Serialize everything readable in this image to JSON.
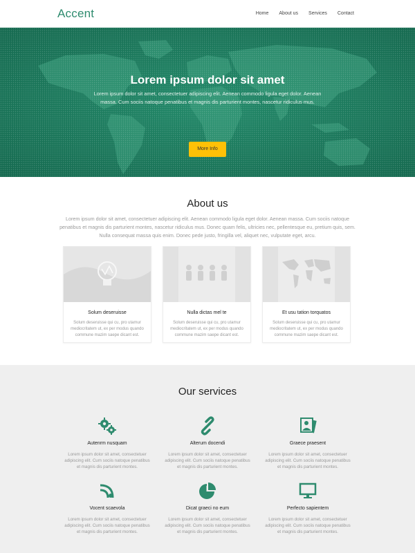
{
  "header": {
    "logo": "Accent",
    "nav": [
      "Home",
      "About us",
      "Services",
      "Contact"
    ]
  },
  "hero": {
    "title": "Lorem ipsum dolor sit amet",
    "text": "Lorem ipsum dolor sit amet, consectetuer adipiscing elit. Aenean commodo ligula eget dolor. Aenean massa. Cum sociis natoque penatibus et magnis dis parturient montes, nascetur ridiculus mus.",
    "button": "More Info"
  },
  "about": {
    "title": "About us",
    "text": "Lorem ipsum dolor sit amet, consectetuer adipiscing elit. Aenean commodo ligula eget dolor. Aenean massa. Cum sociis natoque penatibus et magnis dis parturient montes, nascetur ridiculus mus. Donec quam felis, ultricies nec, pellentesque eu, pretium quis, sem. Nulla consequat massa quis enim. Donec pede justo, fringilla vel, aliquet nec, vulputate eget, arcu.",
    "cards": [
      {
        "title": "Solum deseruisse",
        "text": "Solum deseruisse qui cu, pro utamur mediocritatem ut, ex per modus quando commune mazim saepe dicant est."
      },
      {
        "title": "Nulla dictas mel te",
        "text": "Solum deseruisse qui cu, pro utamur mediocritatem ut, ex per modus quando commune mazim saepe dicant est."
      },
      {
        "title": "Et usu tation torquatos",
        "text": "Solum deseruisse qui cu, pro utamur mediocritatem ut, ex per modus quando commune mazim saepe dicant est."
      }
    ]
  },
  "services": {
    "title": "Our services",
    "items": [
      {
        "icon": "gears-icon",
        "title": "Autenrm nusquam",
        "text": "Lorem ipsum dolor sit amet, consectetuer adipiscing elit. Cum sociis natoque penatibus et magnis dis parturient montes."
      },
      {
        "icon": "link-icon",
        "title": "Alterum docendi",
        "text": "Lorem ipsum dolor sit amet, consectetuer adipiscing elit. Cum sociis natoque penatibus et magnis dis parturient montes."
      },
      {
        "icon": "photos-icon",
        "title": "Graece praesent",
        "text": "Lorem ipsum dolor sit amet, consectetuer adipiscing elit. Cum sociis natoque penatibus et magnis dis parturient montes."
      },
      {
        "icon": "rss-icon",
        "title": "Vocent scaevola",
        "text": "Lorem ipsum dolor sit amet, consectetuer adipiscing elit. Cum sociis natoque penatibus et magnis dis parturient montes."
      },
      {
        "icon": "pie-chart-icon",
        "title": "Dicat graeci no eum",
        "text": "Lorem ipsum dolor sit amet, consectetuer adipiscing elit. Cum sociis natoque penatibus et magnis dis parturient montes."
      },
      {
        "icon": "monitor-icon",
        "title": "Perfecto sapientem",
        "text": "Lorem ipsum dolor sit amet, consectetuer adipiscing elit. Cum sociis natoque penatibus et magnis dis parturient montes."
      }
    ]
  },
  "colors": {
    "brand": "#2e8b6e",
    "hero_bg": "#1f7a5e",
    "button": "#ffc107",
    "services_bg": "#efefef"
  }
}
